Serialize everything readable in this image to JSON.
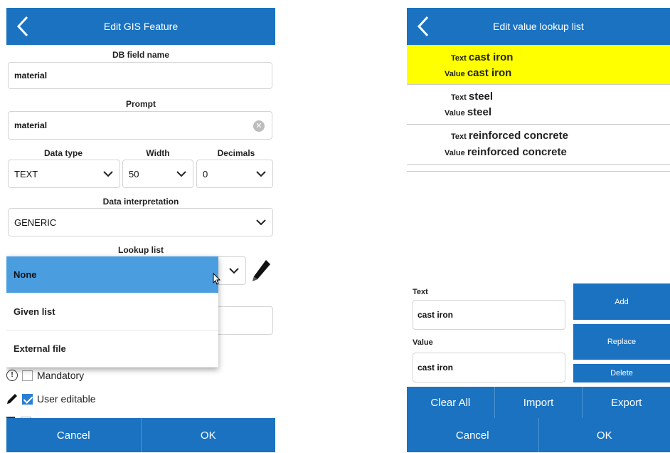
{
  "left": {
    "title": "Edit GIS Feature",
    "db_field": {
      "label": "DB field name",
      "value": "material"
    },
    "prompt": {
      "label": "Prompt",
      "value": "material"
    },
    "data_type": {
      "label": "Data type",
      "value": "TEXT"
    },
    "width": {
      "label": "Width",
      "value": "50"
    },
    "decimals": {
      "label": "Decimals",
      "value": "0"
    },
    "interpretation": {
      "label": "Data interpretation",
      "value": "GENERIC"
    },
    "lookup": {
      "label": "Lookup list",
      "options": [
        "None",
        "Given list",
        "External file"
      ],
      "selected_index": 0
    },
    "checks": {
      "mandatory": {
        "label": "Mandatory",
        "checked": false
      },
      "user_editable": {
        "label": "User editable",
        "checked": true
      }
    },
    "footer": {
      "cancel": "Cancel",
      "ok": "OK"
    }
  },
  "right": {
    "title": "Edit value lookup list",
    "items": [
      {
        "text_label": "Text",
        "text": "cast iron",
        "value_label": "Value",
        "value": "cast iron",
        "highlighted": true
      },
      {
        "text_label": "Text",
        "text": "steel",
        "value_label": "Value",
        "value": "steel",
        "highlighted": false
      },
      {
        "text_label": "Text",
        "text": "reinforced concrete",
        "value_label": "Value",
        "value": "reinforced concrete",
        "highlighted": false
      }
    ],
    "text_input": {
      "label": "Text",
      "value": "cast iron"
    },
    "value_input": {
      "label": "Value",
      "value": "cast iron"
    },
    "buttons": {
      "add": "Add",
      "replace": "Replace",
      "delete": "Delete"
    },
    "toolbar": {
      "clear_all": "Clear All",
      "import": "Import",
      "export": "Export"
    },
    "footer": {
      "cancel": "Cancel",
      "ok": "OK"
    }
  },
  "colors": {
    "primary": "#1a72c0",
    "highlight": "#ffff00",
    "dropdown_selected": "#4a9ee0"
  },
  "icons": [
    "back-arrow-icon",
    "clear-icon",
    "chevron-down-icon",
    "pencil-icon",
    "mouse-cursor-icon",
    "info-icon",
    "checkbox-icon"
  ]
}
